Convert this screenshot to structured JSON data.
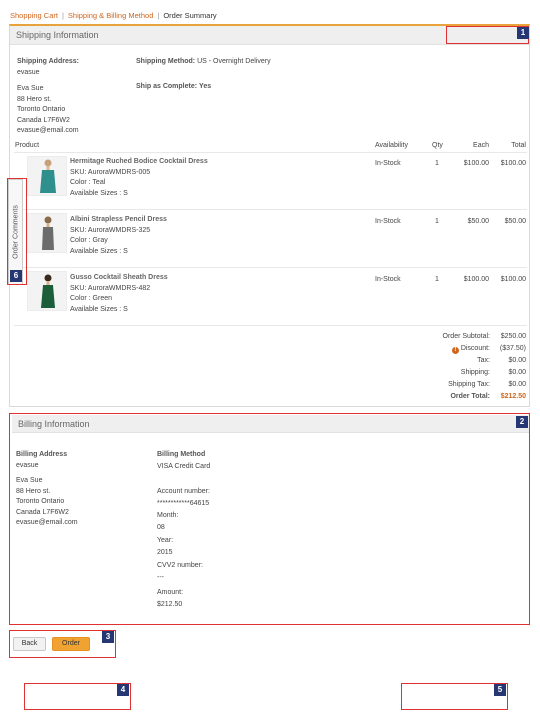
{
  "breadcrumb": {
    "items": [
      "Shopping Cart",
      "Shipping & Billing Method",
      "Order Summary"
    ],
    "separator": "|"
  },
  "shipping": {
    "title": "Shipping Information",
    "address_label": "Shipping Address:",
    "nickname": "evasue",
    "address_lines": [
      "Eva Sue",
      "88 Hero st.",
      "Toronto Ontario",
      "Canada L7F6W2",
      "evasue@email.com"
    ],
    "method_label": "Shipping Method:",
    "method_value": "US - Overnight Delivery",
    "complete_label": "Ship as Complete:",
    "complete_value": "Yes"
  },
  "table": {
    "headers": [
      "Product",
      "Availability",
      "Qty",
      "Each",
      "Total"
    ],
    "rows": [
      {
        "name": "Hermitage Ruched Bodice Cocktail Dress",
        "sku": "SKU: AuroraWMDRS-005",
        "color": "Color : Teal",
        "sizes": "Available Sizes : S",
        "availability": "In-Stock",
        "qty": "1",
        "each": "$100.00",
        "total": "$100.00",
        "swatch": "#2f8f8c"
      },
      {
        "name": "Albini Strapless Pencil Dress",
        "sku": "SKU: AuroraWMDRS-325",
        "color": "Color : Gray",
        "sizes": "Available Sizes : S",
        "availability": "In-Stock",
        "qty": "1",
        "each": "$50.00",
        "total": "$50.00",
        "swatch": "#6c6c6c"
      },
      {
        "name": "Gusso Cocktail Sheath Dress",
        "sku": "SKU: AuroraWMDRS-482",
        "color": "Color : Green",
        "sizes": "Available Sizes : S",
        "availability": "In-Stock",
        "qty": "1",
        "each": "$100.00",
        "total": "$100.00",
        "swatch": "#1d5e3a"
      }
    ]
  },
  "totals": [
    {
      "label": "Order Subtotal:",
      "value": "$250.00"
    },
    {
      "label": "Discount:",
      "value": "($37.50)"
    },
    {
      "label": "Tax:",
      "value": "$0.00"
    },
    {
      "label": "Shipping:",
      "value": "$0.00"
    },
    {
      "label": "Shipping Tax:",
      "value": "$0.00"
    },
    {
      "label": "Order Total:",
      "value": "$212.50"
    }
  ],
  "side_tab": {
    "label": "Order Comments"
  },
  "billing": {
    "title": "Billing Information",
    "address_label": "Billing Address",
    "nickname": "evasue",
    "address_lines": [
      "Eva Sue",
      "88 Hero st.",
      "Toronto Ontario",
      "Canada L7F6W2",
      "evasue@email.com"
    ],
    "method_label": "Billing Method",
    "method_value": "VISA Credit Card",
    "account_label": "Account number:",
    "account_value": "************64615",
    "month_label": "Month:",
    "month_value": "08",
    "year_label": "Year:",
    "year_value": "2015",
    "cvv_label": "CVV2 number:",
    "cvv_value": "---",
    "amount_label": "Amount:",
    "amount_value": "$212.50"
  },
  "buttons": {
    "back": "Back",
    "order": "Order"
  },
  "annotations": [
    "1",
    "2",
    "3",
    "4",
    "5",
    "6"
  ],
  "colors": {
    "accent": "#d0661e",
    "button_primary": "#f0a232",
    "annotation_box": "#e03030",
    "annotation_badge": "#263873"
  }
}
